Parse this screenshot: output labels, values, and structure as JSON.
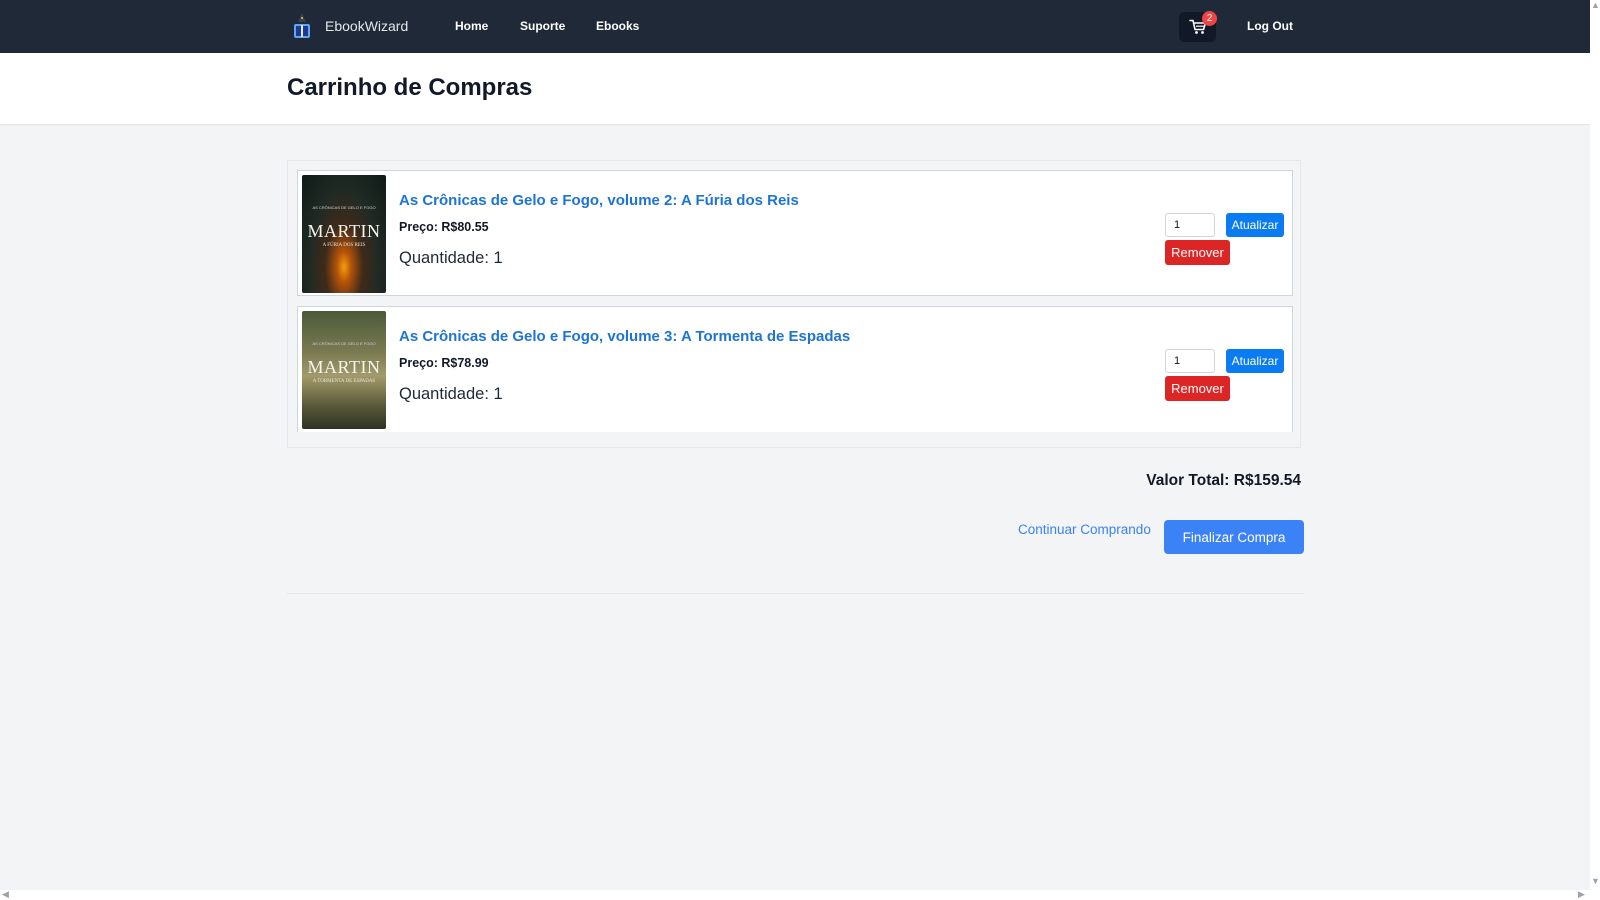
{
  "nav": {
    "brand": "EbookWizard",
    "links": [
      "Home",
      "Suporte",
      "Ebooks"
    ],
    "cart_count": "2",
    "logout": "Log Out"
  },
  "header": {
    "title": "Carrinho de Compras"
  },
  "cart": {
    "items": [
      {
        "title": "As Crônicas de Gelo e Fogo, volume 2: A Fúria dos Reis",
        "price": "Preço: R$80.55",
        "quantity_text": "Quantidade: 1",
        "qty_value": "1",
        "update_label": "Atualizar",
        "remove_label": "Remover",
        "cover_author": "MARTIN",
        "cover_subtitle": "A FÚRIA DOS REIS"
      },
      {
        "title": "As Crônicas de Gelo e Fogo, volume 3: A Tormenta de Espadas",
        "price": "Preço: R$78.99",
        "quantity_text": "Quantidade: 1",
        "qty_value": "1",
        "update_label": "Atualizar",
        "remove_label": "Remover",
        "cover_author": "MARTIN",
        "cover_subtitle": "A TORMENTA DE ESPADAS"
      }
    ],
    "total": "Valor Total: R$159.54",
    "continue_label": "Continuar Comprando",
    "checkout_label": "Finalizar Compra"
  },
  "colors": {
    "nav_bg": "#1f2937",
    "link_blue": "#1d74d4",
    "primary": "#3b82f6",
    "danger": "#dc2626",
    "update": "#0a7bf0"
  }
}
